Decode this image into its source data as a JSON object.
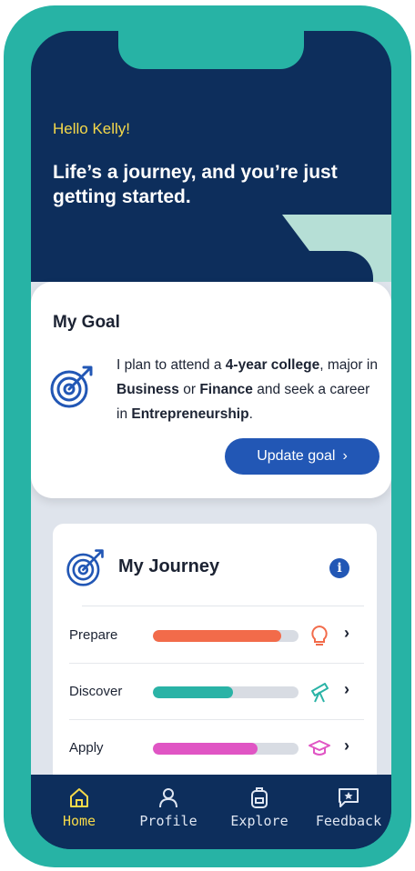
{
  "greeting": "Hello Kelly!",
  "tagline": "Life’s a journey, and you’re just getting started.",
  "goal": {
    "title": "My Goal",
    "text_1": "I plan to attend a ",
    "bold_1": "4-year college",
    "text_2": ", major in ",
    "bold_2": "Business",
    "text_3": " or ",
    "bold_3": "Finance",
    "text_4": " and seek a career in ",
    "bold_4": "Entrepreneurship",
    "text_5": ".",
    "update_label": "Update goal",
    "update_chevron": "›"
  },
  "journey": {
    "title": "My Journey",
    "info": "i",
    "rows": [
      {
        "label": "Prepare",
        "progress": 0.88,
        "color": "#f26b4a",
        "icon": "lightbulb-icon",
        "chevron": "›"
      },
      {
        "label": "Discover",
        "progress": 0.55,
        "color": "#2ab3a6",
        "icon": "telescope-icon",
        "chevron": "›"
      },
      {
        "label": "Apply",
        "progress": 0.72,
        "color": "#e055c4",
        "icon": "graduation-cap-icon",
        "chevron": "›"
      }
    ]
  },
  "tabs": [
    {
      "label": "Home",
      "icon": "home-icon",
      "active": true
    },
    {
      "label": "Profile",
      "icon": "person-icon",
      "active": false
    },
    {
      "label": "Explore",
      "icon": "backpack-icon",
      "active": false
    },
    {
      "label": "Feedback",
      "icon": "star-chat-icon",
      "active": false
    }
  ],
  "colors": {
    "navy": "#0d2e5c",
    "teal": "#27b3a5",
    "accent_yellow": "#f5d94a",
    "button_blue": "#2257b5"
  }
}
